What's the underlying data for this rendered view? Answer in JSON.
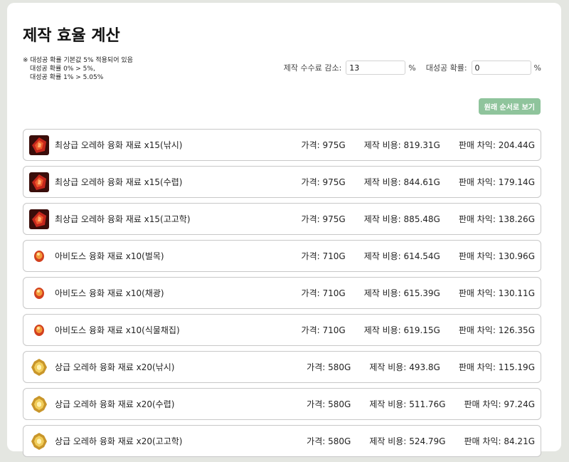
{
  "title": "제작 효율 계산",
  "notes": [
    "※ 대성공 확률 기본값 5% 적용되어 있음",
    "대성공 확률 0% > 5%,",
    "대성공 확률 1% > 5.05%"
  ],
  "controls": {
    "fee_label": "제작 수수료 감소:",
    "fee_value": "13",
    "fee_unit": "%",
    "crit_label": "대성공 확률:",
    "crit_value": "0",
    "crit_unit": "%"
  },
  "sort_button": "원래 순서로 보기",
  "labels": {
    "price": "가격:",
    "cost": "제작 비용:",
    "profit": "판매 차익:"
  },
  "items": [
    {
      "icon": "red-fusion-icon",
      "name": "최상급 오레하 융화 재료 x15(낚시)",
      "price": "975G",
      "cost": "819.31G",
      "profit": "204.44G"
    },
    {
      "icon": "red-fusion-icon",
      "name": "최상급 오레하 융화 재료 x15(수렵)",
      "price": "975G",
      "cost": "844.61G",
      "profit": "179.14G"
    },
    {
      "icon": "red-fusion-icon",
      "name": "최상급 오레하 융화 재료 x15(고고학)",
      "price": "975G",
      "cost": "885.48G",
      "profit": "138.26G"
    },
    {
      "icon": "abidos-fusion-icon",
      "name": "아비도스 융화 재료 x10(벌목)",
      "price": "710G",
      "cost": "614.54G",
      "profit": "130.96G"
    },
    {
      "icon": "abidos-fusion-icon",
      "name": "아비도스 융화 재료 x10(채광)",
      "price": "710G",
      "cost": "615.39G",
      "profit": "130.11G"
    },
    {
      "icon": "abidos-fusion-icon",
      "name": "아비도스 융화 재료 x10(식물채집)",
      "price": "710G",
      "cost": "619.15G",
      "profit": "126.35G"
    },
    {
      "icon": "gold-fusion-icon",
      "name": "상급 오레하 융화 재료 x20(낚시)",
      "price": "580G",
      "cost": "493.8G",
      "profit": "115.19G"
    },
    {
      "icon": "gold-fusion-icon",
      "name": "상급 오레하 융화 재료 x20(수렵)",
      "price": "580G",
      "cost": "511.76G",
      "profit": "97.24G"
    },
    {
      "icon": "gold-fusion-icon",
      "name": "상급 오레하 융화 재료 x20(고고학)",
      "price": "580G",
      "cost": "524.79G",
      "profit": "84.21G"
    }
  ]
}
